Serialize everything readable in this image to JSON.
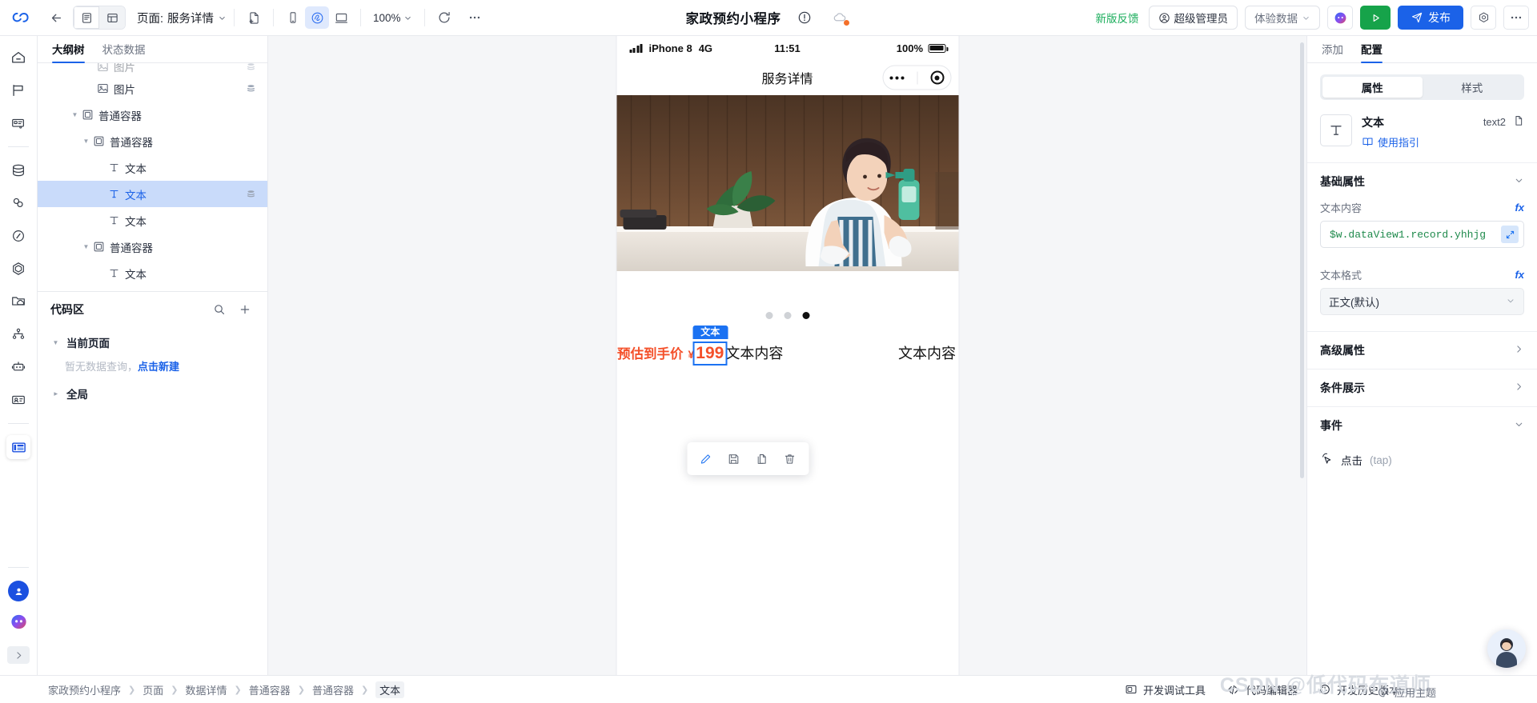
{
  "topbar": {
    "back_icon": "arrow-left-icon",
    "view_doc_label": "document-view",
    "view_grid_label": "grid-view",
    "page_prefix": "页面:",
    "page_name": "服务详情",
    "add_page_icon": "add-page-icon",
    "device_mobile_icon": "mobile-icon",
    "device_mini_icon": "miniprogram-icon",
    "device_desktop_icon": "desktop-icon",
    "zoom_value": "100%",
    "refresh_icon": "refresh-icon",
    "more_icon": "more-icon",
    "app_title": "家政预约小程序",
    "warn_icon": "warning-circle-icon",
    "cloud_icon": "cloud-icon",
    "feedback_label": "新版反馈",
    "role_label": "超级管理员",
    "env_label": "体验数据",
    "ai_icon": "ai-assistant-icon",
    "preview_icon": "play-icon",
    "publish_label": "发布",
    "settings_icon": "gear-icon",
    "overflow_icon": "more-icon"
  },
  "rail": {
    "items": [
      {
        "name": "home-icon"
      },
      {
        "name": "flag-icon"
      },
      {
        "name": "shop-card-icon"
      },
      {
        "name": "database-icon"
      },
      {
        "name": "link-icon"
      },
      {
        "name": "slash-hexagon-icon"
      },
      {
        "name": "hexagon-icon"
      },
      {
        "name": "folder-cloud-icon"
      },
      {
        "name": "sitemap-icon"
      },
      {
        "name": "robot-icon"
      },
      {
        "name": "id-card-icon"
      },
      {
        "name": "layout-panel-icon"
      }
    ],
    "avatar_icon": "user-avatar-icon",
    "assistant_icon": "assistant-face-icon",
    "collapse_icon": "chevron-right-icon"
  },
  "outline": {
    "tabs": [
      {
        "label": "大纲树",
        "active": true
      },
      {
        "label": "状态数据",
        "active": false
      }
    ],
    "nodes": [
      {
        "label": "图片",
        "icon": "image-icon",
        "depth": 3,
        "type": "leaf",
        "data": true,
        "selected": false,
        "clipped": true
      },
      {
        "label": "图片",
        "icon": "image-icon",
        "depth": 3,
        "type": "leaf",
        "data": true,
        "selected": false
      },
      {
        "label": "普通容器",
        "icon": "container-icon",
        "depth": 2,
        "type": "branch",
        "data": false,
        "selected": false
      },
      {
        "label": "普通容器",
        "icon": "container-icon",
        "depth": 3,
        "type": "branch",
        "data": false,
        "selected": false
      },
      {
        "label": "文本",
        "icon": "text-icon",
        "depth": 4,
        "type": "leaf",
        "data": false,
        "selected": false
      },
      {
        "label": "文本",
        "icon": "text-icon",
        "depth": 4,
        "type": "leaf",
        "data": true,
        "selected": true
      },
      {
        "label": "文本",
        "icon": "text-icon",
        "depth": 4,
        "type": "leaf",
        "data": false,
        "selected": false
      },
      {
        "label": "普通容器",
        "icon": "container-icon",
        "depth": 3,
        "type": "branch",
        "data": false,
        "selected": false
      },
      {
        "label": "文本",
        "icon": "text-icon",
        "depth": 4,
        "type": "leaf",
        "data": false,
        "selected": false
      }
    ],
    "code_section": {
      "title": "代码区",
      "search_icon": "search-icon",
      "add_icon": "plus-icon",
      "groups": [
        {
          "label": "当前页面",
          "expanded": true,
          "empty_text": "暂无数据查询，",
          "empty_link": "点击新建"
        },
        {
          "label": "全局",
          "expanded": false
        }
      ]
    }
  },
  "canvas": {
    "status_bar": {
      "device": "iPhone 8",
      "network": "4G",
      "time": "11:51",
      "battery_pct": "100%",
      "signal_icon": "signal-bars-icon",
      "battery_icon": "battery-icon"
    },
    "nav_title": "服务详情",
    "capsule": {
      "more_icon": "more-dots-icon",
      "target_icon": "target-icon"
    },
    "carousel_dots": [
      false,
      false,
      true
    ],
    "price_label": "预估到手价",
    "currency": "¥",
    "price_value": "199",
    "selection_badge": "文本",
    "text_after_price": "文本内容",
    "text_right": "文本内容",
    "float_toolbar": [
      {
        "name": "edit-icon"
      },
      {
        "name": "save-icon"
      },
      {
        "name": "copy-icon"
      },
      {
        "name": "delete-icon"
      }
    ]
  },
  "rpanel": {
    "tabs": [
      {
        "label": "添加",
        "active": false
      },
      {
        "label": "配置",
        "active": true
      }
    ],
    "segments": [
      {
        "label": "属性",
        "active": true
      },
      {
        "label": "样式",
        "active": false
      }
    ],
    "component": {
      "icon": "text-component-icon",
      "name": "文本",
      "guide_label": "使用指引",
      "guide_icon": "book-icon",
      "id": "text2",
      "copy_icon": "copy-icon"
    },
    "sections": [
      {
        "title": "基础属性",
        "expanded": true
      },
      {
        "title": "高级属性",
        "expanded": false
      },
      {
        "title": "条件展示",
        "expanded": false
      },
      {
        "title": "事件",
        "expanded": true
      }
    ],
    "fields": {
      "text_content_label": "文本内容",
      "text_content_value": "$w.dataView1.record.yhhjg",
      "fx_label": "fx",
      "text_format_label": "文本格式",
      "text_format_value": "正文(默认)",
      "expand_icon": "expand-icon"
    },
    "event": {
      "icon": "click-cursor-icon",
      "label": "点击",
      "suffix": "(tap)"
    }
  },
  "bottombar": {
    "breadcrumb": [
      "家政预约小程序",
      "页面",
      "数据详情",
      "普通容器",
      "普通容器",
      "文本"
    ],
    "actions": [
      {
        "label": "开发调试工具",
        "icon": "devtools-icon"
      },
      {
        "label": "代码编辑器",
        "icon": "code-icon"
      },
      {
        "label": "开发历史版本",
        "icon": "history-icon"
      }
    ],
    "theme_label": "应用主题",
    "theme_icon": "palette-icon",
    "watermark": "CSDN @低代码布道师",
    "chat_icon": "chat-avatar-icon"
  },
  "colors": {
    "accent": "#1b62e8",
    "publish": "#1b62e8",
    "preview": "#16a34a",
    "price": "#f4502a",
    "selection": "#1b72f2",
    "code_green": "#1f8a4c"
  }
}
